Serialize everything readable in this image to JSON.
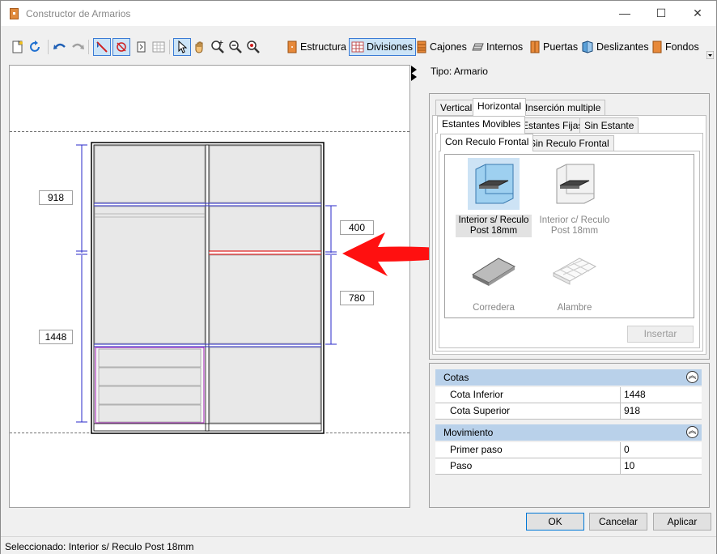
{
  "window": {
    "title": "Constructor de Armarios",
    "min_glyph": "—",
    "max_glyph": "☐",
    "close_glyph": "✕"
  },
  "toolbar": {
    "buttons": [
      {
        "label": "Estructura",
        "icon": "wardrobe-icon"
      },
      {
        "label": "Divisiones",
        "icon": "grid-icon"
      },
      {
        "label": "Cajones",
        "icon": "drawers-icon"
      },
      {
        "label": "Internos",
        "icon": "shelves-icon"
      },
      {
        "label": "Puertas",
        "icon": "door-icon"
      },
      {
        "label": "Deslizantes",
        "icon": "sliding-door-icon"
      },
      {
        "label": "Fondos",
        "icon": "back-panel-icon"
      }
    ]
  },
  "canvas": {
    "dims": [
      "918",
      "1448",
      "400",
      "780"
    ]
  },
  "side": {
    "tipo": "Tipo: Armario"
  },
  "tabs1": [
    "Vertical",
    "Horizontal",
    "Inserción multiple"
  ],
  "tabs2": [
    "Estantes Movibles",
    "Estantes Fijas",
    "Sin Estante"
  ],
  "tabs3": [
    "Con Reculo Frontal",
    "Sin Reculo Frontal"
  ],
  "gallery": [
    {
      "label": "Interior s/ Reculo Post 18mm"
    },
    {
      "label": "Interior c/ Reculo Post 18mm"
    },
    {
      "label": "Corredera"
    },
    {
      "label": "Alambre"
    }
  ],
  "insert_button": "Insertar",
  "props": {
    "cat1": "Cotas",
    "rows1": [
      {
        "name": "Cota Inferior",
        "value": "1448"
      },
      {
        "name": "Cota Superior",
        "value": "918"
      }
    ],
    "cat2": "Movimiento",
    "rows2": [
      {
        "name": "Primer paso",
        "value": "0"
      },
      {
        "name": "Paso",
        "value": "10"
      }
    ],
    "collapse_glyph": "︽"
  },
  "buttons": {
    "ok": "OK",
    "cancel": "Cancelar",
    "apply": "Aplicar"
  },
  "status": "Seleccionado: Interior s/ Reculo Post 18mm",
  "colors": {
    "accent": "#0078d7",
    "dim_line": "#2a2ac8",
    "highlight": "#e02020",
    "drawer": "#b040c0",
    "category": "#b9d1ea"
  }
}
